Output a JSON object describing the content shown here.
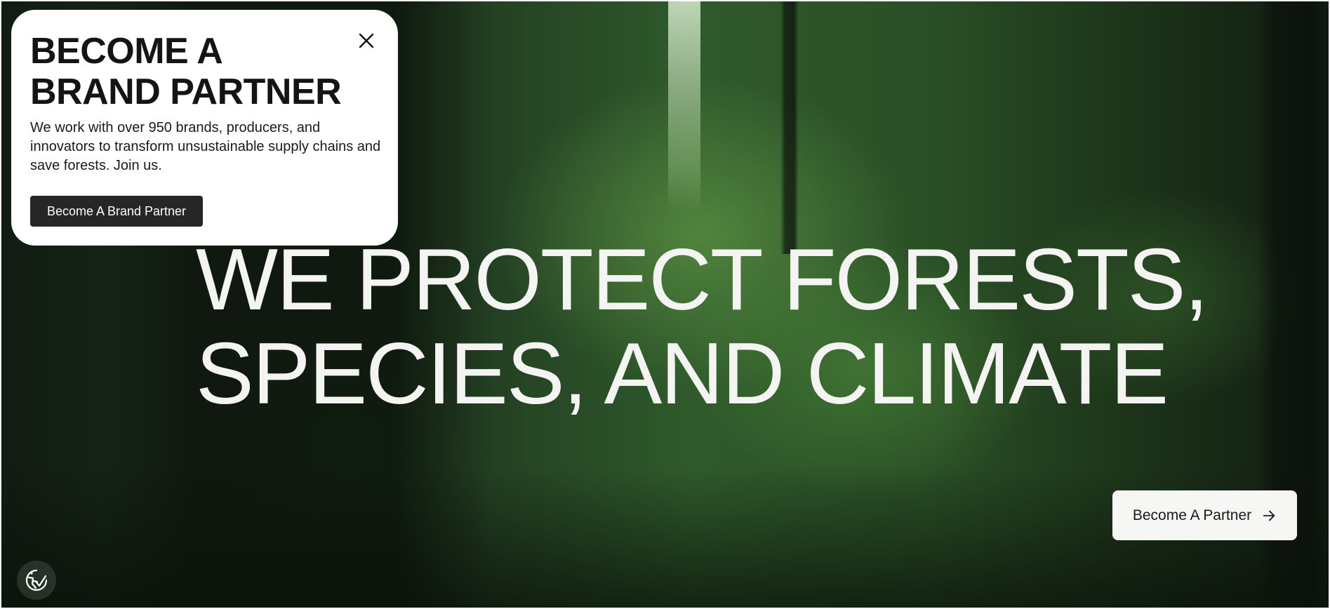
{
  "popup": {
    "title_line1": "BECOME A",
    "title_line2": "BRAND PARTNER",
    "body": "We work with over 950 brands, producers, and innovators to transform unsustainable supply chains and save forests. Join us.",
    "button_label": "Become A Brand Partner",
    "close_icon": "close-icon"
  },
  "hero": {
    "headline_line1": "WE PROTECT FORESTS,",
    "headline_line2": "SPECIES, AND CLIMATE",
    "cta_label": "Become A Partner",
    "cta_icon": "arrow-right-icon"
  },
  "accessibility": {
    "icon": "accessibility-icon"
  },
  "colors": {
    "popup_background": "#ffffff",
    "dark_button": "#262626",
    "headline_text": "#f4f4f2",
    "cta_background": "#f6f6f4"
  }
}
